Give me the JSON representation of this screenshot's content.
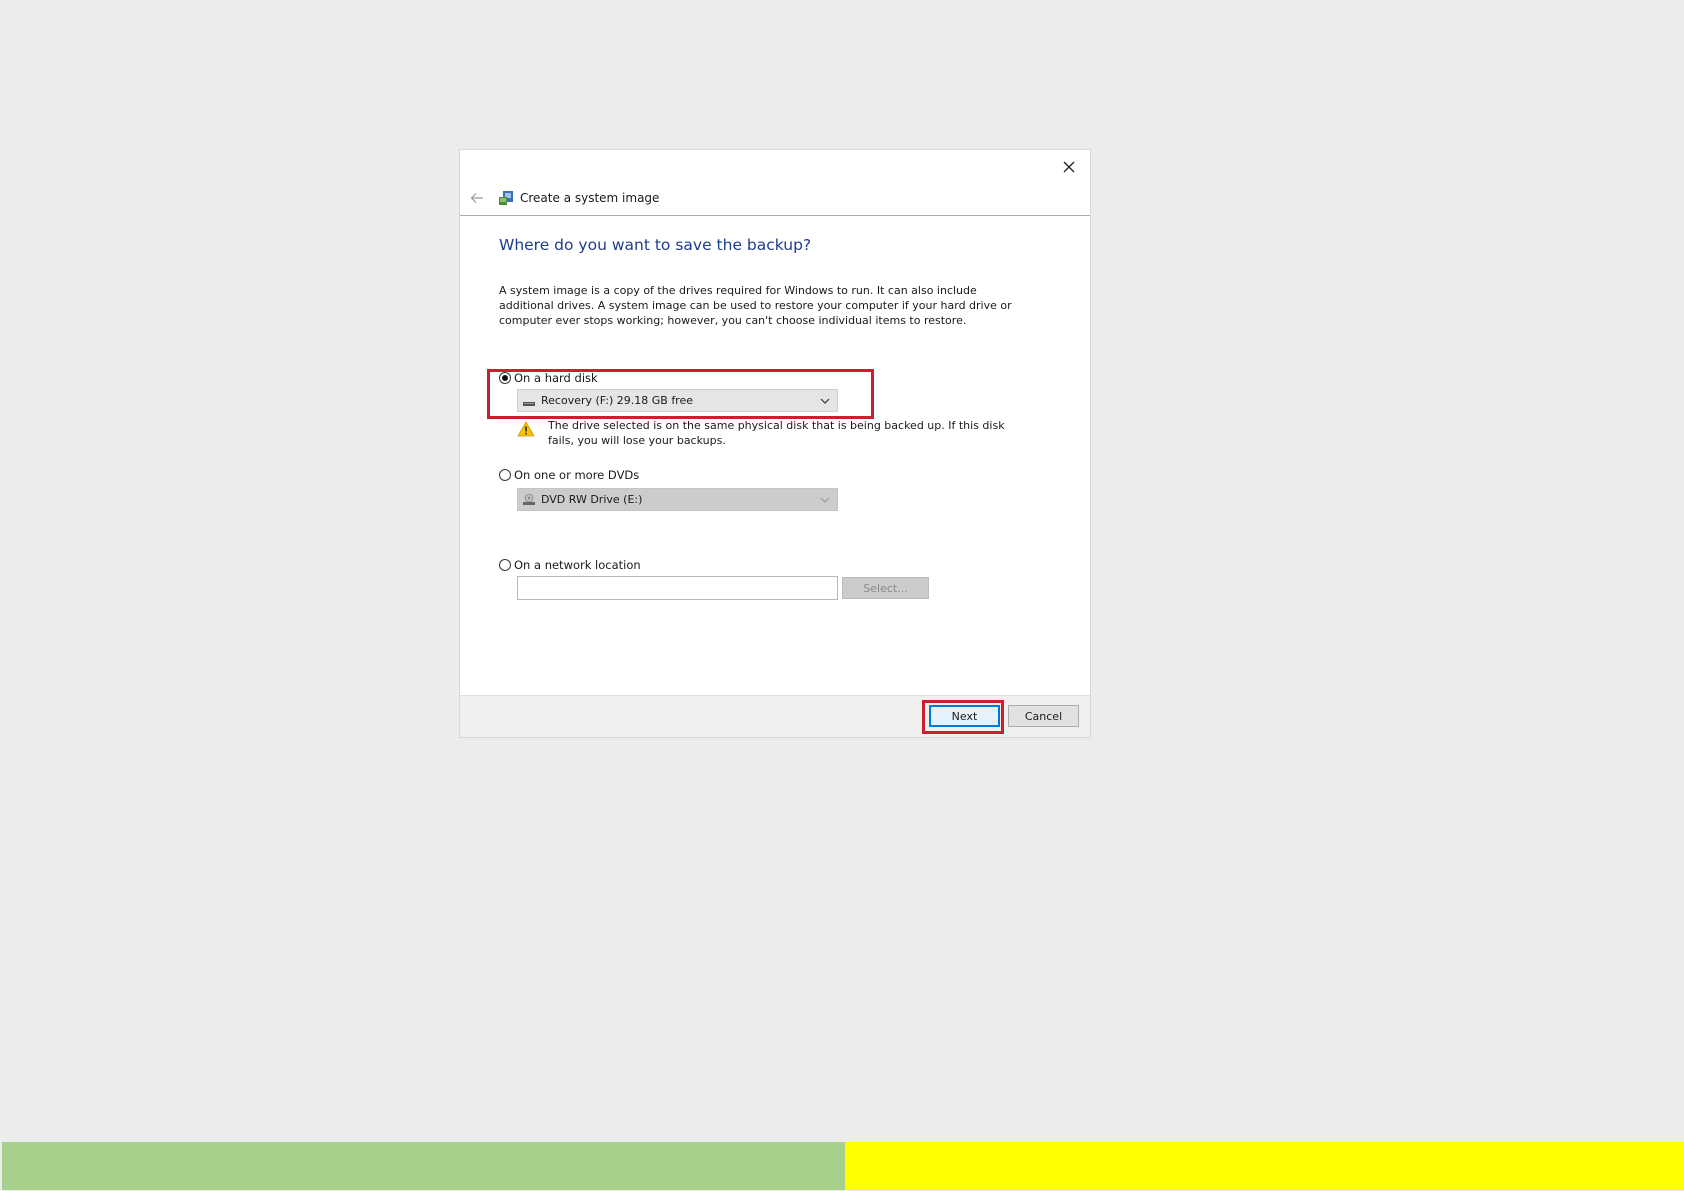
{
  "dialog": {
    "title": "Create a system image",
    "heading": "Where do you want to save the backup?",
    "description": "A system image is a copy of the drives required for Windows to run. It can also include additional drives. A system image can be used to restore your computer if your hard drive or computer ever stops working; however, you can't choose individual items to restore.",
    "icons": {
      "close": "close-icon",
      "back": "back-arrow-icon",
      "title": "system-image-icon"
    }
  },
  "options": {
    "hard_disk": {
      "label": "On a hard disk",
      "selected": true,
      "drive_value": "Recovery (F:)  29.18 GB free",
      "warning": "The drive selected is on the same physical disk that is being backed up. If this disk fails, you will lose your backups."
    },
    "dvd": {
      "label": "On one or more DVDs",
      "selected": false,
      "drive_value": "DVD RW Drive (E:)"
    },
    "network": {
      "label": "On a network location",
      "selected": false,
      "path_value": "",
      "select_label": "Select..."
    }
  },
  "footer": {
    "next_label": "Next",
    "cancel_label": "Cancel"
  },
  "colors": {
    "heading": "#1e3d8f",
    "highlight": "#cc1f2d",
    "bar_green": "#a7d08c",
    "bar_yellow": "#ffff00"
  }
}
